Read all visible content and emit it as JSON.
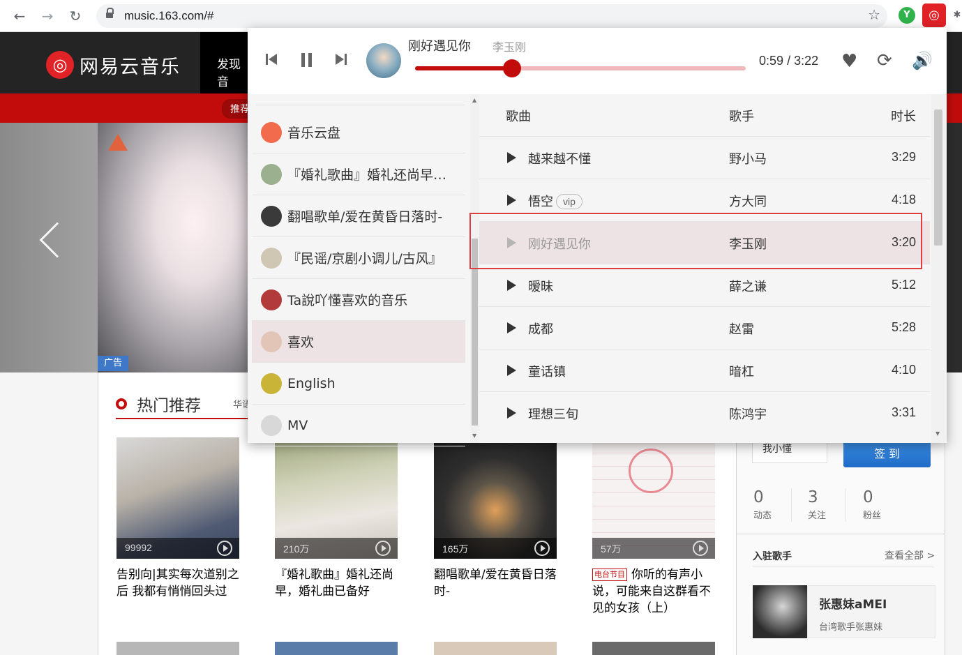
{
  "browser": {
    "url": "music.163.com/#",
    "back_glyph": "←",
    "forward_glyph": "→",
    "reload_glyph": "↻",
    "star_glyph": "☆",
    "ext1_glyph": "Y",
    "ext2_glyph": "◎",
    "ext3_glyph": "✱"
  },
  "header": {
    "logo_glyph": "◎",
    "logo_text": "网易云音乐",
    "nav_discover": "发现音",
    "subnav_recommend": "推荐"
  },
  "banner": {
    "ad_label": "广告"
  },
  "hot": {
    "title": "热门推荐",
    "tag": "华语"
  },
  "cards": [
    {
      "count": "99992",
      "title": "告别向|其实每次道别之后 我都有悄悄回头过",
      "radio": ""
    },
    {
      "count": "210万",
      "title": "『婚礼歌曲』婚礼还尚早，婚礼曲已备好",
      "radio": ""
    },
    {
      "count": "165万",
      "title": "翻唱歌单/爱在黄昏日落时-",
      "radio": ""
    },
    {
      "count": "57万",
      "title": "你听的有声小说，可能来自这群看不见的女孩（上）",
      "radio": "电台节目"
    }
  ],
  "sidebar": {
    "sign_prev": "我小懂",
    "sign_label": "签 到",
    "stats": [
      {
        "num": "0",
        "label": "动态"
      },
      {
        "num": "3",
        "label": "关注"
      },
      {
        "num": "0",
        "label": "粉丝"
      }
    ],
    "singer_head": "入驻歌手",
    "singer_all": "查看全部 >",
    "singer_name": "张惠妹aMEI",
    "singer_desc": "台湾歌手张惠妹"
  },
  "player": {
    "song_title": "刚好遇见你",
    "song_artist": "李玉刚",
    "elapsed": "0:59",
    "sep": "/",
    "total": "3:22",
    "progress": 0.293,
    "heart_glyph": "♥",
    "loop_glyph": "⟳",
    "volume_glyph": "🔊"
  },
  "playlists": [
    {
      "label": "音乐云盘",
      "color": "#f26b4d",
      "active": false
    },
    {
      "label": "『婚礼歌曲』婚礼还尚早，婚礼曲已备好",
      "color": "#9bb08f",
      "active": false
    },
    {
      "label": "翻唱歌单/爱在黄昏日落时-",
      "color": "#3a3a3a",
      "active": false
    },
    {
      "label": "『民谣/京剧小调儿/古风』",
      "color": "#cfc6b3",
      "active": false
    },
    {
      "label": "Ta說吖懂喜欢的音乐",
      "color": "#b23a3a",
      "active": false
    },
    {
      "label": "喜欢",
      "color": "#e3c5b8",
      "active": true
    },
    {
      "label": "English",
      "color": "#c9b437",
      "active": false
    },
    {
      "label": "MV",
      "color": "#d8d8d8",
      "active": false
    }
  ],
  "song_table": {
    "col_song": "歌曲",
    "col_artist": "歌手",
    "col_duration": "时长",
    "rows": [
      {
        "name": "越来越不懂",
        "vip": "",
        "artist": "野小马",
        "duration": "3:29",
        "current": false
      },
      {
        "name": "悟空",
        "vip": "vip",
        "artist": "方大同",
        "duration": "4:18",
        "current": false
      },
      {
        "name": "刚好遇见你",
        "vip": "",
        "artist": "李玉刚",
        "duration": "3:20",
        "current": true
      },
      {
        "name": "暧昧",
        "vip": "",
        "artist": "薛之谦",
        "duration": "5:12",
        "current": false
      },
      {
        "name": "成都",
        "vip": "",
        "artist": "赵雷",
        "duration": "5:28",
        "current": false
      },
      {
        "name": "童话镇",
        "vip": "",
        "artist": "暗杠",
        "duration": "4:10",
        "current": false
      },
      {
        "name": "理想三旬",
        "vip": "",
        "artist": "陈鸿宇",
        "duration": "3:31",
        "current": false
      }
    ]
  }
}
